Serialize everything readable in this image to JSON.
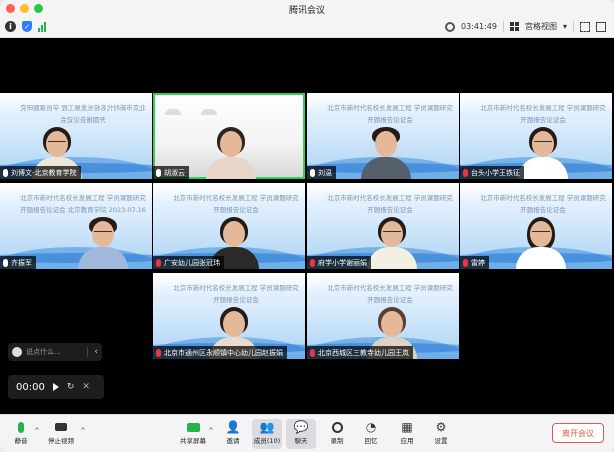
{
  "window": {
    "title": "腾讯会议"
  },
  "status": {
    "timer": "03:41:49",
    "view_label": "宫格视图"
  },
  "participants": [
    {
      "name": "刘博文-北京教育学院",
      "bg_text": "北京市新时代名校长发展工程 学员课题研究开题报告论证会"
    },
    {
      "name": "胡淑云"
    },
    {
      "name": "刘温",
      "bg_text": "北京市新时代名校长发展工程 学员课题研究开题报告论证会"
    },
    {
      "name": "台头小学王铁征",
      "bg_text": "北京市新时代名校长发展工程 学员课题研究开题报告论证会"
    },
    {
      "name": "齐振军",
      "bg_text": "北京市新时代名校长发展工程 学员课题研究开题报告论证会 北京教育学院 2023.07.16"
    },
    {
      "name": "广安幼儿园张冠玮",
      "bg_text": "北京市新时代名校长发展工程 学员课题研究开题报告论证会"
    },
    {
      "name": "府学小学谢丽娟",
      "bg_text": "北京市新时代名校长发展工程 学员课题研究开题报告论证会"
    },
    {
      "name": "雷婷",
      "bg_text": "北京市新时代名校长发展工程 学员课题研究开题报告论证会"
    },
    {
      "name": "北京市通州区永顺镇中心幼儿园赵振娟",
      "bg_text": "北京市新时代名校长发展工程 学员课题研究开题报告论证会"
    },
    {
      "name": "北京西城区三教寺幼儿园王岚",
      "bg_text": "北京市新时代名校长发展工程 学员课题研究开题报告论证会"
    }
  ],
  "chat": {
    "placeholder": "说点什么..."
  },
  "recording": {
    "time": "00:00"
  },
  "toolbar": {
    "mute": "静音",
    "stop_video": "停止视频",
    "share": "共享屏幕",
    "invite": "邀请",
    "members": "成员(10)",
    "chat": "聊天",
    "record": "录制",
    "apps_review": "回忆",
    "apps": "应用",
    "settings": "设置",
    "leave": "离开会议"
  }
}
